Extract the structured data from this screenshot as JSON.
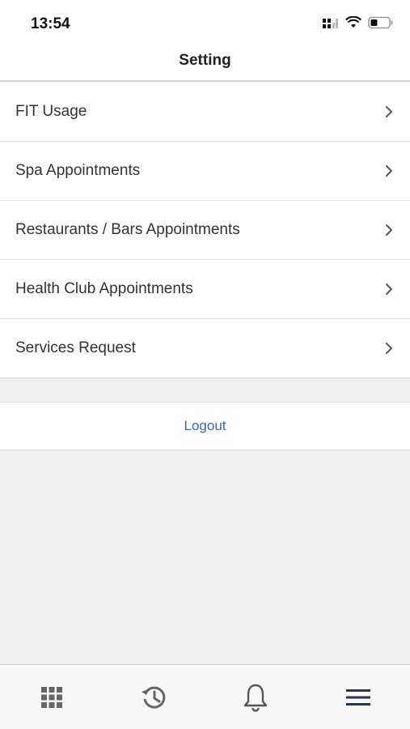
{
  "status_bar": {
    "time": "13:54",
    "icons": [
      "cellular-signal-icon",
      "wifi-icon",
      "battery-icon"
    ]
  },
  "header": {
    "title": "Setting"
  },
  "menu": {
    "items": [
      {
        "label": "FIT Usage",
        "icon": "chevron-right-icon"
      },
      {
        "label": "Spa Appointments",
        "icon": "chevron-right-icon"
      },
      {
        "label": "Restaurants / Bars Appointments",
        "icon": "chevron-right-icon"
      },
      {
        "label": "Health Club Appointments",
        "icon": "chevron-right-icon"
      },
      {
        "label": "Services Request",
        "icon": "chevron-right-icon"
      }
    ]
  },
  "logout": {
    "label": "Logout",
    "color": "#3b6aa8"
  },
  "tab_bar": {
    "tabs": [
      {
        "icon": "grid-icon"
      },
      {
        "icon": "history-icon"
      },
      {
        "icon": "bell-icon"
      },
      {
        "icon": "menu-icon"
      }
    ]
  }
}
